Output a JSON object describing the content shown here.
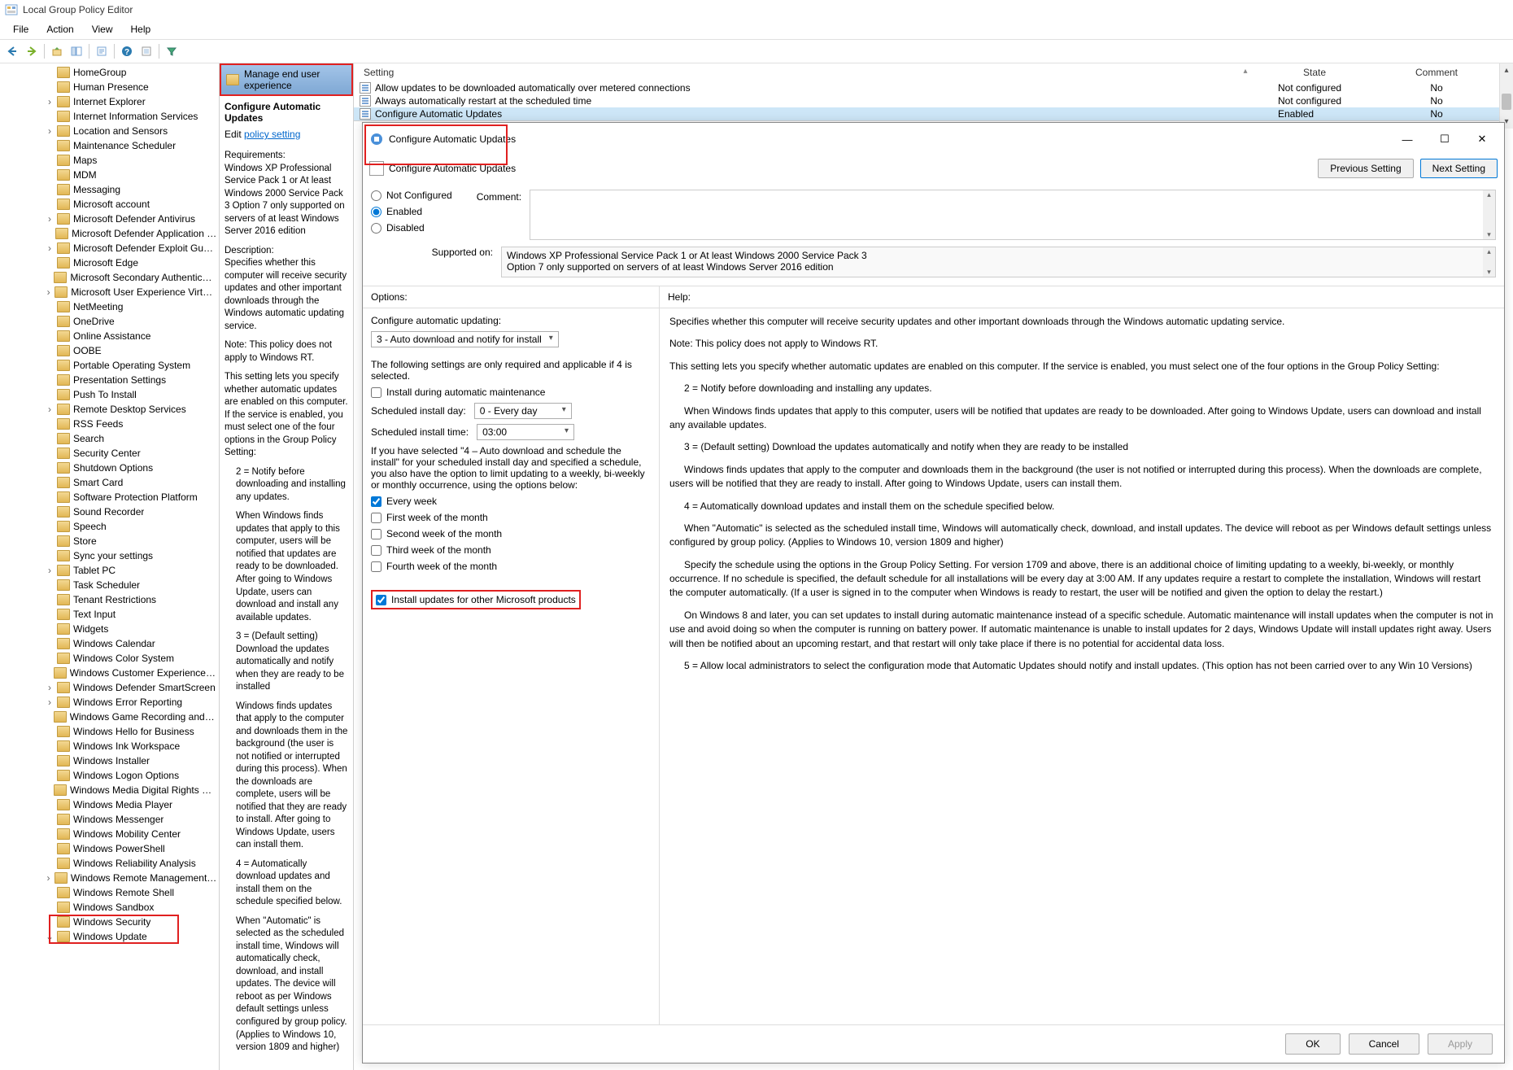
{
  "app": {
    "title": "Local Group Policy Editor"
  },
  "menu": [
    "File",
    "Action",
    "View",
    "Help"
  ],
  "tree": {
    "items": [
      {
        "label": "HomeGroup",
        "indent": 1,
        "exp": ""
      },
      {
        "label": "Human Presence",
        "indent": 1,
        "exp": ""
      },
      {
        "label": "Internet Explorer",
        "indent": 1,
        "exp": ">"
      },
      {
        "label": "Internet Information Services",
        "indent": 1,
        "exp": ""
      },
      {
        "label": "Location and Sensors",
        "indent": 1,
        "exp": ">"
      },
      {
        "label": "Maintenance Scheduler",
        "indent": 1,
        "exp": ""
      },
      {
        "label": "Maps",
        "indent": 1,
        "exp": ""
      },
      {
        "label": "MDM",
        "indent": 1,
        "exp": ""
      },
      {
        "label": "Messaging",
        "indent": 1,
        "exp": ""
      },
      {
        "label": "Microsoft account",
        "indent": 1,
        "exp": ""
      },
      {
        "label": "Microsoft Defender Antivirus",
        "indent": 1,
        "exp": ">"
      },
      {
        "label": "Microsoft Defender Application Guard",
        "indent": 1,
        "exp": ""
      },
      {
        "label": "Microsoft Defender Exploit Guard",
        "indent": 1,
        "exp": ">"
      },
      {
        "label": "Microsoft Edge",
        "indent": 1,
        "exp": ""
      },
      {
        "label": "Microsoft Secondary Authentication Factor",
        "indent": 1,
        "exp": ""
      },
      {
        "label": "Microsoft User Experience Virtualization",
        "indent": 1,
        "exp": ">"
      },
      {
        "label": "NetMeeting",
        "indent": 1,
        "exp": ""
      },
      {
        "label": "OneDrive",
        "indent": 1,
        "exp": ""
      },
      {
        "label": "Online Assistance",
        "indent": 1,
        "exp": ""
      },
      {
        "label": "OOBE",
        "indent": 1,
        "exp": ""
      },
      {
        "label": "Portable Operating System",
        "indent": 1,
        "exp": ""
      },
      {
        "label": "Presentation Settings",
        "indent": 1,
        "exp": ""
      },
      {
        "label": "Push To Install",
        "indent": 1,
        "exp": ""
      },
      {
        "label": "Remote Desktop Services",
        "indent": 1,
        "exp": ">"
      },
      {
        "label": "RSS Feeds",
        "indent": 1,
        "exp": ""
      },
      {
        "label": "Search",
        "indent": 1,
        "exp": ""
      },
      {
        "label": "Security Center",
        "indent": 1,
        "exp": ""
      },
      {
        "label": "Shutdown Options",
        "indent": 1,
        "exp": ""
      },
      {
        "label": "Smart Card",
        "indent": 1,
        "exp": ""
      },
      {
        "label": "Software Protection Platform",
        "indent": 1,
        "exp": ""
      },
      {
        "label": "Sound Recorder",
        "indent": 1,
        "exp": ""
      },
      {
        "label": "Speech",
        "indent": 1,
        "exp": ""
      },
      {
        "label": "Store",
        "indent": 1,
        "exp": ""
      },
      {
        "label": "Sync your settings",
        "indent": 1,
        "exp": ""
      },
      {
        "label": "Tablet PC",
        "indent": 1,
        "exp": ">"
      },
      {
        "label": "Task Scheduler",
        "indent": 1,
        "exp": ""
      },
      {
        "label": "Tenant Restrictions",
        "indent": 1,
        "exp": ""
      },
      {
        "label": "Text Input",
        "indent": 1,
        "exp": ""
      },
      {
        "label": "Widgets",
        "indent": 1,
        "exp": ""
      },
      {
        "label": "Windows Calendar",
        "indent": 1,
        "exp": ""
      },
      {
        "label": "Windows Color System",
        "indent": 1,
        "exp": ""
      },
      {
        "label": "Windows Customer Experience Improvement",
        "indent": 1,
        "exp": ""
      },
      {
        "label": "Windows Defender SmartScreen",
        "indent": 1,
        "exp": ">"
      },
      {
        "label": "Windows Error Reporting",
        "indent": 1,
        "exp": ">"
      },
      {
        "label": "Windows Game Recording and Broadcasting",
        "indent": 1,
        "exp": ""
      },
      {
        "label": "Windows Hello for Business",
        "indent": 1,
        "exp": ""
      },
      {
        "label": "Windows Ink Workspace",
        "indent": 1,
        "exp": ""
      },
      {
        "label": "Windows Installer",
        "indent": 1,
        "exp": ""
      },
      {
        "label": "Windows Logon Options",
        "indent": 1,
        "exp": ""
      },
      {
        "label": "Windows Media Digital Rights Management",
        "indent": 1,
        "exp": ""
      },
      {
        "label": "Windows Media Player",
        "indent": 1,
        "exp": ""
      },
      {
        "label": "Windows Messenger",
        "indent": 1,
        "exp": ""
      },
      {
        "label": "Windows Mobility Center",
        "indent": 1,
        "exp": ""
      },
      {
        "label": "Windows PowerShell",
        "indent": 1,
        "exp": ""
      },
      {
        "label": "Windows Reliability Analysis",
        "indent": 1,
        "exp": ""
      },
      {
        "label": "Windows Remote Management (WinRM)",
        "indent": 1,
        "exp": ">"
      },
      {
        "label": "Windows Remote Shell",
        "indent": 1,
        "exp": ""
      },
      {
        "label": "Windows Sandbox",
        "indent": 1,
        "exp": ""
      },
      {
        "label": "Windows Security",
        "indent": 1,
        "exp": ""
      },
      {
        "label": "Windows Update",
        "indent": 1,
        "exp": "v",
        "selected": true
      }
    ]
  },
  "mid": {
    "header": "Manage end user experience",
    "title": "Configure Automatic Updates",
    "edit_prefix": "Edit ",
    "edit_link": "policy setting",
    "requirements_h": "Requirements:",
    "requirements": "Windows XP Professional Service Pack 1 or At least Windows 2000 Service Pack 3 Option 7 only supported on servers of at least Windows Server 2016 edition",
    "description_h": "Description:",
    "desc1": "Specifies whether this computer will receive security updates and other important downloads through the Windows automatic updating service.",
    "desc2": "Note: This policy does not apply to Windows RT.",
    "desc3": "This setting lets you specify whether automatic updates are enabled on this computer. If the service is enabled, you must select one of the four options in the Group Policy Setting:",
    "opt2": "2 = Notify before downloading and installing any updates.",
    "opt2_detail": "When Windows finds updates that apply to this computer, users will be notified that updates are ready to be downloaded. After going to Windows Update, users can download and install any available updates.",
    "opt3": "3 = (Default setting) Download the updates automatically and notify when they are ready to be installed",
    "opt3_detail": "Windows finds updates that apply to the computer and downloads them in the background (the user is not notified or interrupted during this process). When the downloads are complete, users will be notified that they are ready to install. After going to Windows Update, users can install them.",
    "opt4": "4 = Automatically download updates and install them on the schedule specified below.",
    "opt4_detail": "When \"Automatic\" is selected as the scheduled install time, Windows will automatically check, download, and install updates. The device will reboot as per Windows default settings unless configured by group policy. (Applies to Windows 10, version 1809 and higher)"
  },
  "settings": {
    "cols": {
      "setting": "Setting",
      "state": "State",
      "comment": "Comment"
    },
    "rows": [
      {
        "name": "Allow updates to be downloaded automatically over metered connections",
        "state": "Not configured",
        "comment": "No"
      },
      {
        "name": "Always automatically restart at the scheduled time",
        "state": "Not configured",
        "comment": "No"
      },
      {
        "name": "Configure Automatic Updates",
        "state": "Enabled",
        "comment": "No",
        "selected": true
      }
    ]
  },
  "dialog": {
    "title": "Configure Automatic Updates",
    "subtitle": "Configure Automatic Updates",
    "prev": "Previous Setting",
    "next": "Next Setting",
    "radios": {
      "not_configured": "Not Configured",
      "enabled": "Enabled",
      "disabled": "Disabled"
    },
    "selected_radio": "enabled",
    "comment_label": "Comment:",
    "supported_label": "Supported on:",
    "supported_text": "Windows XP Professional Service Pack 1 or At least Windows 2000 Service Pack 3\nOption 7 only supported on servers of at least Windows Server 2016 edition",
    "options_h": "Options:",
    "help_h": "Help:",
    "opts": {
      "cfg_label": "Configure automatic updating:",
      "cfg_value": "3 - Auto download and notify for install",
      "note4": "The following settings are only required and applicable if 4 is selected.",
      "install_maint": "Install during automatic maintenance",
      "day_label": "Scheduled install day:",
      "day_value": "0 - Every day",
      "time_label": "Scheduled install time:",
      "time_value": "03:00",
      "sched_note": "If you have selected \"4 – Auto download and schedule the install\" for your scheduled install day and specified a schedule, you also have the option to limit updating to a weekly, bi-weekly or monthly occurrence, using the options below:",
      "wk_every": "Every week",
      "wk1": "First week of the month",
      "wk2": "Second week of the month",
      "wk3": "Third week of the month",
      "wk4": "Fourth week of the month",
      "other_prod": "Install updates for other Microsoft products"
    },
    "help": {
      "p1": "Specifies whether this computer will receive security updates and other important downloads through the Windows automatic updating service.",
      "p2": "Note: This policy does not apply to Windows RT.",
      "p3": "This setting lets you specify whether automatic updates are enabled on this computer. If the service is enabled, you must select one of the four options in the Group Policy Setting:",
      "p4": "2 = Notify before downloading and installing any updates.",
      "p5": "When Windows finds updates that apply to this computer, users will be notified that updates are ready to be downloaded. After going to Windows Update, users can download and install any available updates.",
      "p6": "3 = (Default setting) Download the updates automatically and notify when they are ready to be installed",
      "p7": "Windows finds updates that apply to the computer and downloads them in the background (the user is not notified or interrupted during this process). When the downloads are complete, users will be notified that they are ready to install. After going to Windows Update, users can install them.",
      "p8": "4 = Automatically download updates and install them on the schedule specified below.",
      "p9": "When \"Automatic\" is selected as the scheduled install time, Windows will automatically check, download, and install updates. The device will reboot as per Windows default settings unless configured by group policy. (Applies to Windows 10, version 1809 and higher)",
      "p10": "Specify the schedule using the options in the Group Policy Setting. For version 1709 and above, there is an additional choice of limiting updating to a weekly, bi-weekly, or monthly occurrence. If no schedule is specified, the default schedule for all installations will be every day at 3:00 AM. If any updates require a restart to complete the installation, Windows will restart the computer automatically. (If a user is signed in to the computer when Windows is ready to restart, the user will be notified and given the option to delay the restart.)",
      "p11": "On Windows 8 and later, you can set updates to install during automatic maintenance instead of a specific schedule. Automatic maintenance will install updates when the computer is not in use and avoid doing so when the computer is running on battery power. If automatic maintenance is unable to install updates for 2 days, Windows Update will install updates right away. Users will then be notified about an upcoming restart, and that restart will only take place if there is no potential for accidental data loss.",
      "p12": "5 = Allow local administrators to select the configuration mode that Automatic Updates should notify and install updates. (This option has not been carried over to any Win 10 Versions)"
    },
    "buttons": {
      "ok": "OK",
      "cancel": "Cancel",
      "apply": "Apply"
    }
  }
}
